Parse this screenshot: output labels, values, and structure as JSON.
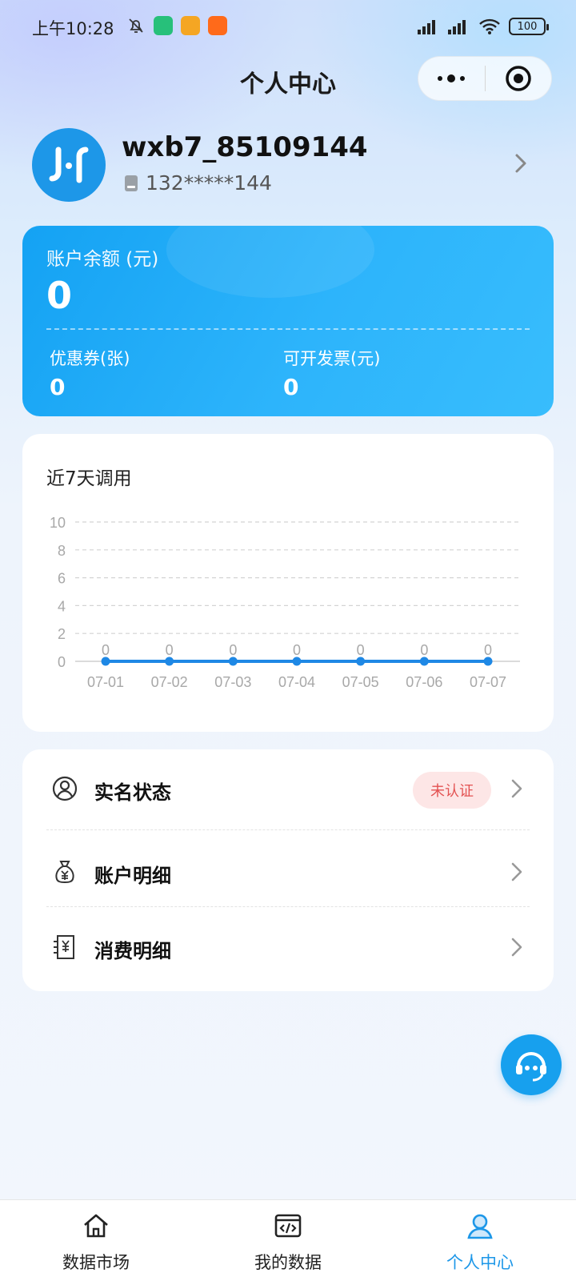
{
  "status_bar": {
    "time": "上午10:28",
    "battery": "100"
  },
  "navbar": {
    "title": "个人中心"
  },
  "profile": {
    "username": "wxb7_85109144",
    "phone": "132*****144",
    "avatar_text": "J·f"
  },
  "balance": {
    "label": "账户余额 (元)",
    "value": "0",
    "coupons_label": "优惠券(张)",
    "coupons_value": "0",
    "invoice_label": "可开发票(元)",
    "invoice_value": "0"
  },
  "calls_chart": {
    "title": "近7天调用"
  },
  "chart_data": {
    "type": "line",
    "title": "近7天调用",
    "x": [
      "07-01",
      "07-02",
      "07-03",
      "07-04",
      "07-05",
      "07-06",
      "07-07"
    ],
    "series": [
      {
        "values": [
          0,
          0,
          0,
          0,
          0,
          0,
          0
        ]
      }
    ],
    "yticks": [
      0,
      2,
      4,
      6,
      8,
      10
    ],
    "ylim": [
      0,
      10
    ],
    "grid": true,
    "color": "#1e88e5",
    "data_labels": true
  },
  "menu": {
    "items": [
      {
        "label": "实名状态",
        "icon": "user-circle-icon",
        "badge": "未认证"
      },
      {
        "label": "账户明细",
        "icon": "money-bag-icon"
      },
      {
        "label": "消费明细",
        "icon": "receipt-icon"
      }
    ]
  },
  "tabbar": {
    "tabs": [
      {
        "label": "数据市场",
        "icon": "home-icon",
        "active": false
      },
      {
        "label": "我的数据",
        "icon": "code-icon",
        "active": false
      },
      {
        "label": "个人中心",
        "icon": "user-icon",
        "active": true
      }
    ]
  },
  "colors": {
    "accent": "#1d97e8",
    "badge_bg": "#fde6e6",
    "badge_text": "#e35252"
  }
}
